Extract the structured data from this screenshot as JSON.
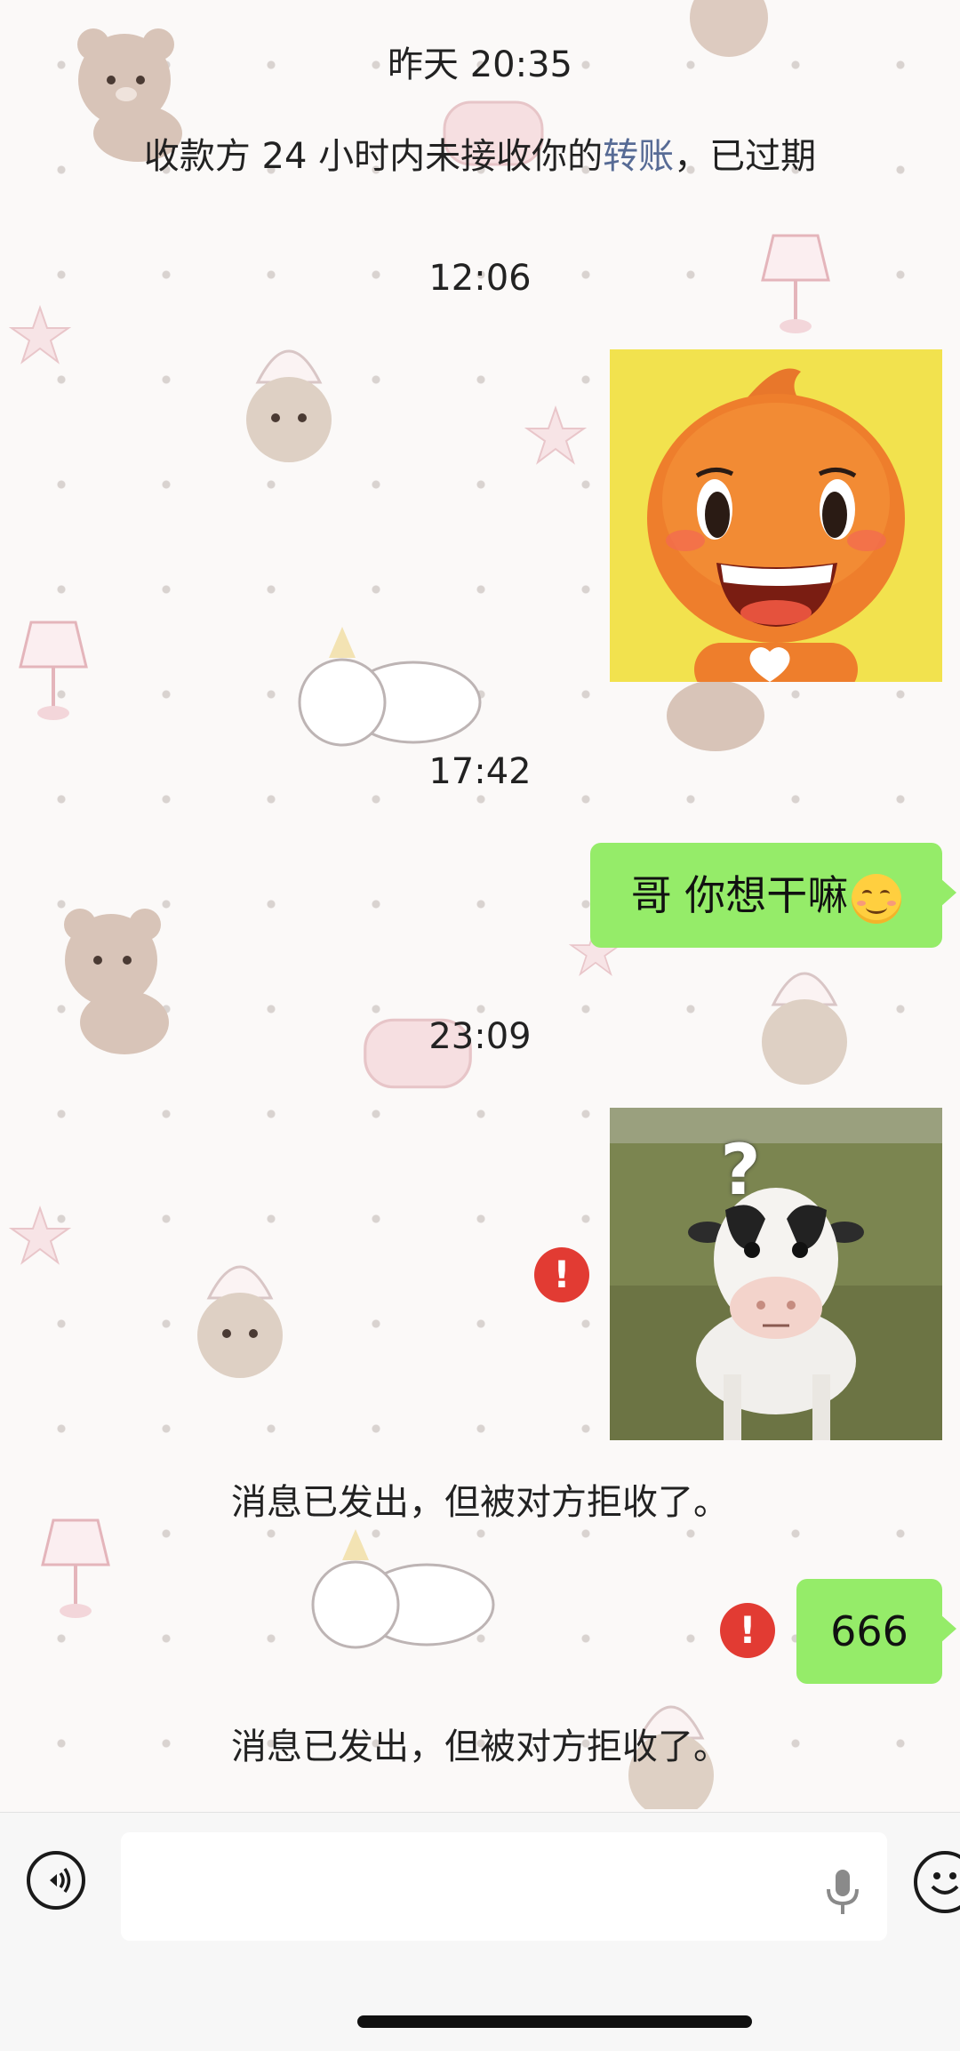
{
  "chat": {
    "timestamps": [
      "昨天 20:35",
      "12:06",
      "17:42",
      "23:09"
    ],
    "transfer_notice": {
      "prefix": "收款方 24 小时内未接收你的",
      "link": "转账",
      "suffix": "，已过期"
    },
    "messages": {
      "text_1": "哥 你想干嘛",
      "text_2": "666",
      "error_mark": "!"
    },
    "rejected_notice": "消息已发出，但被对方拒收了。",
    "sticker_2_label": "?"
  },
  "input_bar": {
    "placeholder": "",
    "voice_icon": "voice-mode-icon",
    "emoji_icon": "emoji-icon",
    "mic_icon": "microphone-icon"
  },
  "colors": {
    "bubble_green": "#95ec69",
    "error_red": "#e23b33",
    "link_blue": "#576b95",
    "sticker1_bg": "#f2e24e"
  }
}
